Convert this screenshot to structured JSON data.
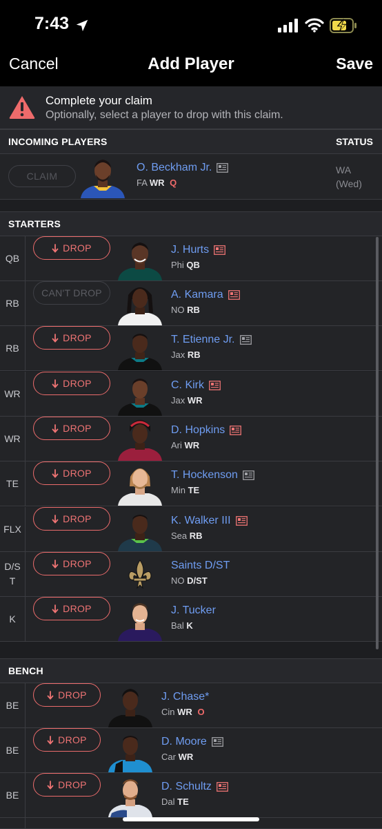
{
  "status_bar": {
    "time": "7:43"
  },
  "nav": {
    "cancel": "Cancel",
    "title": "Add Player",
    "save": "Save"
  },
  "alert": {
    "title": "Complete your claim",
    "subtitle": "Optionally, select a player to drop with this claim."
  },
  "incoming": {
    "header": "INCOMING PLAYERS",
    "status_header": "STATUS",
    "player": {
      "claim_label": "CLAIM",
      "name": "O. Beckham Jr.",
      "team": "FA",
      "pos": "WR",
      "injury": "Q",
      "status_line1": "WA",
      "status_line2": "(Wed)"
    }
  },
  "starters": {
    "header": "STARTERS",
    "rows": [
      {
        "slot": "QB",
        "button": "DROP",
        "name": "J. Hurts",
        "team": "Phi",
        "pos": "QB"
      },
      {
        "slot": "RB",
        "button": "CAN'T DROP",
        "name": "A. Kamara",
        "team": "NO",
        "pos": "RB"
      },
      {
        "slot": "RB",
        "button": "DROP",
        "name": "T. Etienne Jr.",
        "team": "Jax",
        "pos": "RB"
      },
      {
        "slot": "WR",
        "button": "DROP",
        "name": "C. Kirk",
        "team": "Jax",
        "pos": "WR"
      },
      {
        "slot": "WR",
        "button": "DROP",
        "name": "D. Hopkins",
        "team": "Ari",
        "pos": "WR"
      },
      {
        "slot": "TE",
        "button": "DROP",
        "name": "T. Hockenson",
        "team": "Min",
        "pos": "TE"
      },
      {
        "slot": "FLX",
        "button": "DROP",
        "name": "K. Walker III",
        "team": "Sea",
        "pos": "RB"
      },
      {
        "slot": "D/ST",
        "button": "DROP",
        "name": "Saints D/ST",
        "team": "NO",
        "pos": "D/ST"
      },
      {
        "slot": "K",
        "button": "DROP",
        "name": "J. Tucker",
        "team": "Bal",
        "pos": "K"
      }
    ]
  },
  "bench": {
    "header": "BENCH",
    "rows": [
      {
        "slot": "BE",
        "button": "DROP",
        "name": "J. Chase*",
        "team": "Cin",
        "pos": "WR",
        "injury": "O"
      },
      {
        "slot": "BE",
        "button": "DROP",
        "name": "D. Moore",
        "team": "Car",
        "pos": "WR"
      },
      {
        "slot": "BE",
        "button": "DROP",
        "name": "D. Schultz",
        "team": "Dal",
        "pos": "TE"
      }
    ]
  },
  "colors": {
    "link": "#6f9df2",
    "drop": "#ef7474",
    "injury": "#ef6a6a",
    "background": "#1d1e21"
  }
}
